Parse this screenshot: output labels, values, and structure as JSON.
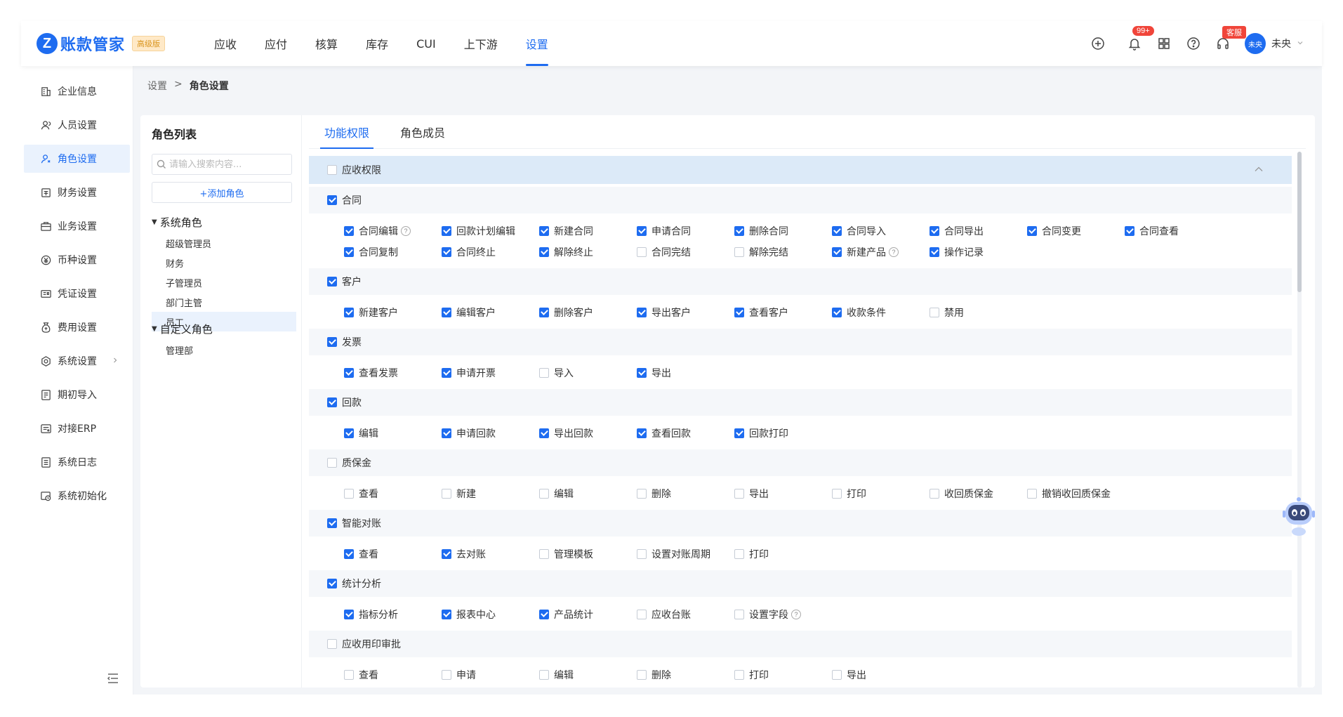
{
  "header": {
    "logo_text": "账款管家",
    "edition": "高级版",
    "nav": [
      "应收",
      "应付",
      "核算",
      "库存",
      "CUI",
      "上下游",
      "设置"
    ],
    "active_nav": "设置",
    "notification_count": "99+",
    "support_label": "客服",
    "avatar_text": "未央",
    "username": "未央"
  },
  "sidebar": {
    "items": [
      {
        "label": "企业信息",
        "icon": "building-icon"
      },
      {
        "label": "人员设置",
        "icon": "user-icon"
      },
      {
        "label": "角色设置",
        "icon": "role-icon"
      },
      {
        "label": "财务设置",
        "icon": "finance-icon"
      },
      {
        "label": "业务设置",
        "icon": "briefcase-icon"
      },
      {
        "label": "币种设置",
        "icon": "currency-icon"
      },
      {
        "label": "凭证设置",
        "icon": "voucher-icon"
      },
      {
        "label": "费用设置",
        "icon": "expense-icon"
      },
      {
        "label": "系统设置",
        "icon": "system-icon"
      },
      {
        "label": "期初导入",
        "icon": "import-icon"
      },
      {
        "label": "对接ERP",
        "icon": "erp-icon"
      },
      {
        "label": "系统日志",
        "icon": "log-icon"
      },
      {
        "label": "系统初始化",
        "icon": "init-icon"
      }
    ]
  },
  "breadcrumb": {
    "parent": "设置",
    "sep": ">",
    "current": "角色设置"
  },
  "roles": {
    "title": "角色列表",
    "search_placeholder": "请输入搜索内容...",
    "add_label": "+添加角色",
    "system_group": "系统角色",
    "system_roles": [
      "超级管理员",
      "财务",
      "子管理员",
      "部门主管",
      "员工"
    ],
    "custom_group": "自定义角色",
    "custom_roles": [
      "管理部"
    ]
  },
  "tabs": [
    "功能权限",
    "角色成员"
  ],
  "permissions": [
    {
      "head": "应收权限",
      "checked": false,
      "top": true,
      "items": []
    },
    {
      "head": "合同",
      "checked": true,
      "items": [
        {
          "label": "合同编辑",
          "checked": true,
          "help": true
        },
        {
          "label": "回款计划编辑",
          "checked": true
        },
        {
          "label": "新建合同",
          "checked": true
        },
        {
          "label": "申请合同",
          "checked": true
        },
        {
          "label": "删除合同",
          "checked": true
        },
        {
          "label": "合同导入",
          "checked": true
        },
        {
          "label": "合同导出",
          "checked": true
        },
        {
          "label": "合同变更",
          "checked": true
        },
        {
          "label": "合同查看",
          "checked": true
        },
        {
          "label": "合同复制",
          "checked": true
        },
        {
          "label": "合同终止",
          "checked": true
        },
        {
          "label": "解除终止",
          "checked": true
        },
        {
          "label": "合同完结",
          "checked": false
        },
        {
          "label": "解除完结",
          "checked": false
        },
        {
          "label": "新建产品",
          "checked": true,
          "help": true
        },
        {
          "label": "操作记录",
          "checked": true
        }
      ]
    },
    {
      "head": "客户",
      "checked": true,
      "items": [
        {
          "label": "新建客户",
          "checked": true
        },
        {
          "label": "编辑客户",
          "checked": true
        },
        {
          "label": "删除客户",
          "checked": true
        },
        {
          "label": "导出客户",
          "checked": true
        },
        {
          "label": "查看客户",
          "checked": true
        },
        {
          "label": "收款条件",
          "checked": true
        },
        {
          "label": "禁用",
          "checked": false
        }
      ]
    },
    {
      "head": "发票",
      "checked": true,
      "items": [
        {
          "label": "查看发票",
          "checked": true
        },
        {
          "label": "申请开票",
          "checked": true
        },
        {
          "label": "导入",
          "checked": false
        },
        {
          "label": "导出",
          "checked": true
        }
      ]
    },
    {
      "head": "回款",
      "checked": true,
      "items": [
        {
          "label": "编辑",
          "checked": true
        },
        {
          "label": "申请回款",
          "checked": true
        },
        {
          "label": "导出回款",
          "checked": true
        },
        {
          "label": "查看回款",
          "checked": true
        },
        {
          "label": "回款打印",
          "checked": true
        }
      ]
    },
    {
      "head": "质保金",
      "checked": false,
      "items": [
        {
          "label": "查看",
          "checked": false
        },
        {
          "label": "新建",
          "checked": false
        },
        {
          "label": "编辑",
          "checked": false
        },
        {
          "label": "删除",
          "checked": false
        },
        {
          "label": "导出",
          "checked": false
        },
        {
          "label": "打印",
          "checked": false
        },
        {
          "label": "收回质保金",
          "checked": false
        },
        {
          "label": "撤销收回质保金",
          "checked": false
        }
      ]
    },
    {
      "head": "智能对账",
      "checked": true,
      "items": [
        {
          "label": "查看",
          "checked": true
        },
        {
          "label": "去对账",
          "checked": true
        },
        {
          "label": "管理模板",
          "checked": false
        },
        {
          "label": "设置对账周期",
          "checked": false
        },
        {
          "label": "打印",
          "checked": false
        }
      ]
    },
    {
      "head": "统计分析",
      "checked": true,
      "items": [
        {
          "label": "指标分析",
          "checked": true
        },
        {
          "label": "报表中心",
          "checked": true
        },
        {
          "label": "产品统计",
          "checked": true
        },
        {
          "label": "应收台账",
          "checked": false
        },
        {
          "label": "设置字段",
          "checked": false,
          "help": true
        }
      ]
    },
    {
      "head": "应收用印审批",
      "checked": false,
      "items": [
        {
          "label": "查看",
          "checked": false
        },
        {
          "label": "申请",
          "checked": false
        },
        {
          "label": "编辑",
          "checked": false
        },
        {
          "label": "删除",
          "checked": false
        },
        {
          "label": "打印",
          "checked": false
        },
        {
          "label": "导出",
          "checked": false
        }
      ]
    }
  ],
  "colors": {
    "accent": "#1e6cf0",
    "badge": "#f0453a"
  }
}
